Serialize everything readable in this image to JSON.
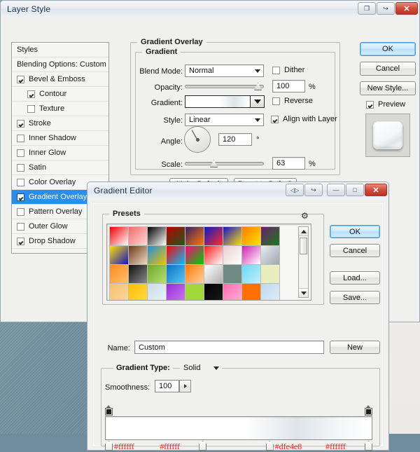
{
  "desktop": {
    "bg_color": "#7794a3"
  },
  "layer_style": {
    "title": "Layer Style",
    "window_buttons": [
      {
        "name": "restore-down-button",
        "glyph": "❐"
      },
      {
        "name": "help-export-button",
        "glyph": "↪"
      },
      {
        "name": "close-button",
        "glyph": "✕"
      }
    ],
    "styles_panel": {
      "header": "Styles",
      "blending_options": "Blending Options: Custom",
      "items": [
        {
          "label": "Bevel & Emboss",
          "checked": true,
          "indent": false,
          "selected": false
        },
        {
          "label": "Contour",
          "checked": true,
          "indent": true,
          "selected": false
        },
        {
          "label": "Texture",
          "checked": false,
          "indent": true,
          "selected": false
        },
        {
          "label": "Stroke",
          "checked": true,
          "indent": false,
          "selected": false
        },
        {
          "label": "Inner Shadow",
          "checked": false,
          "indent": false,
          "selected": false
        },
        {
          "label": "Inner Glow",
          "checked": false,
          "indent": false,
          "selected": false
        },
        {
          "label": "Satin",
          "checked": false,
          "indent": false,
          "selected": false
        },
        {
          "label": "Color Overlay",
          "checked": false,
          "indent": false,
          "selected": false
        },
        {
          "label": "Gradient Overlay",
          "checked": true,
          "indent": false,
          "selected": true
        },
        {
          "label": "Pattern Overlay",
          "checked": false,
          "indent": false,
          "selected": false
        },
        {
          "label": "Outer Glow",
          "checked": false,
          "indent": false,
          "selected": false
        },
        {
          "label": "Drop Shadow",
          "checked": true,
          "indent": false,
          "selected": false
        }
      ]
    },
    "panel": {
      "group_title": "Gradient Overlay",
      "subgroup_title": "Gradient",
      "blend_mode_label": "Blend Mode:",
      "blend_mode_value": "Normal",
      "dither_label": "Dither",
      "dither_checked": false,
      "opacity_label": "Opacity:",
      "opacity_value": "100",
      "opacity_unit": "%",
      "gradient_label": "Gradient:",
      "reverse_label": "Reverse",
      "reverse_checked": false,
      "style_label": "Style:",
      "style_value": "Linear",
      "align_label": "Align with Layer",
      "align_checked": true,
      "angle_label": "Angle:",
      "angle_value": "120",
      "angle_unit": "°",
      "scale_label": "Scale:",
      "scale_value": "63",
      "scale_unit": "%",
      "make_default": "Make Default",
      "reset_default": "Reset to Default"
    },
    "buttons": {
      "ok": "OK",
      "cancel": "Cancel",
      "new_style": "New Style...",
      "preview_label": "Preview",
      "preview_checked": true
    }
  },
  "gradient_editor": {
    "title": "Gradient Editor",
    "window_buttons": [
      {
        "name": "dock-toggle-button",
        "glyph": "◁▷"
      },
      {
        "name": "panel-menu-button",
        "glyph": "↪"
      },
      {
        "name": "minimize-button",
        "glyph": "—"
      },
      {
        "name": "maximize-button",
        "glyph": "□"
      },
      {
        "name": "close-button",
        "glyph": "✕"
      }
    ],
    "presets_label": "Presets",
    "gear_glyph": "⚙",
    "buttons": {
      "ok": "OK",
      "cancel": "Cancel",
      "load": "Load...",
      "save": "Save..."
    },
    "name_label": "Name:",
    "name_value": "Custom",
    "new_button": "New",
    "gradient_type_label": "Gradient Type:",
    "gradient_type_value": "Solid",
    "smoothness_label": "Smoothness:",
    "smoothness_value": "100",
    "smoothness_unit": "%",
    "swatches": [
      [
        "#f00000",
        "#ffffff"
      ],
      [
        "#f26a6a",
        "#ffd9d9"
      ],
      [
        "#000000",
        "#ffffff"
      ],
      [
        "#c00000",
        "#1c5a1c"
      ],
      [
        "#3b1f6b",
        "#ff7a00"
      ],
      [
        "#0b1cc4",
        "#ff2d2d"
      ],
      [
        "#1414d2",
        "#ffe000"
      ],
      [
        "#ff7a00",
        "#ffe400"
      ],
      [
        "#6b1f6b",
        "#1c7a1c"
      ],
      [
        "#ffe000",
        "#1414c8"
      ],
      [
        "#6b3a1c",
        "#f0d8c0"
      ],
      [
        "#1f8fe0",
        "#f0c000"
      ],
      [
        "#ff0000",
        "#00c0ff"
      ],
      [
        "#ff0080",
        "#00d000"
      ],
      [
        "#ff1a1a",
        "#ffffff"
      ],
      [
        "#e8d0d0",
        "#ffffff"
      ],
      [
        "#d020b0",
        "#ffffff"
      ],
      [
        "#e8eef2",
        "#9aa6ae"
      ],
      [
        "#ff8a1a",
        "#ffc070"
      ],
      [
        "#101010",
        "#8a8a8a"
      ],
      [
        "#6aa82a",
        "#b8e070"
      ],
      [
        "#0b6fc4",
        "#58c8f5"
      ],
      [
        "#ff7a00",
        "#ffd0a0"
      ],
      [
        "#ffffff",
        "#b0b0b0"
      ],
      [
        "#6f8a82",
        "#6f8a82"
      ],
      [
        "#6ad8f5",
        "#bff0fb"
      ],
      [
        "#e8eebe",
        "#e8eebe"
      ],
      [
        "#f2c070",
        "#ffd89a"
      ],
      [
        "#ffc000",
        "#ffd84a"
      ],
      [
        "#c8dce8",
        "#eaf2f7"
      ],
      [
        "#9a2ad8",
        "#c87af0"
      ],
      [
        "#a0d83a",
        "#a0d83a"
      ],
      [
        "#000000",
        "#1a1a1a"
      ],
      [
        "#ff6ab0",
        "#ffb0d8"
      ],
      [
        "#ff7000",
        "#ff7000"
      ],
      [
        "#bcd8ee",
        "#e0eef8"
      ]
    ],
    "stops": [
      {
        "hex": "#ffffff",
        "position": 0
      },
      {
        "hex": "#ffffff",
        "position": 38
      },
      {
        "hex": "#dfe4e8",
        "position": 63
      },
      {
        "hex": "#ffffff",
        "position": 100
      }
    ]
  }
}
